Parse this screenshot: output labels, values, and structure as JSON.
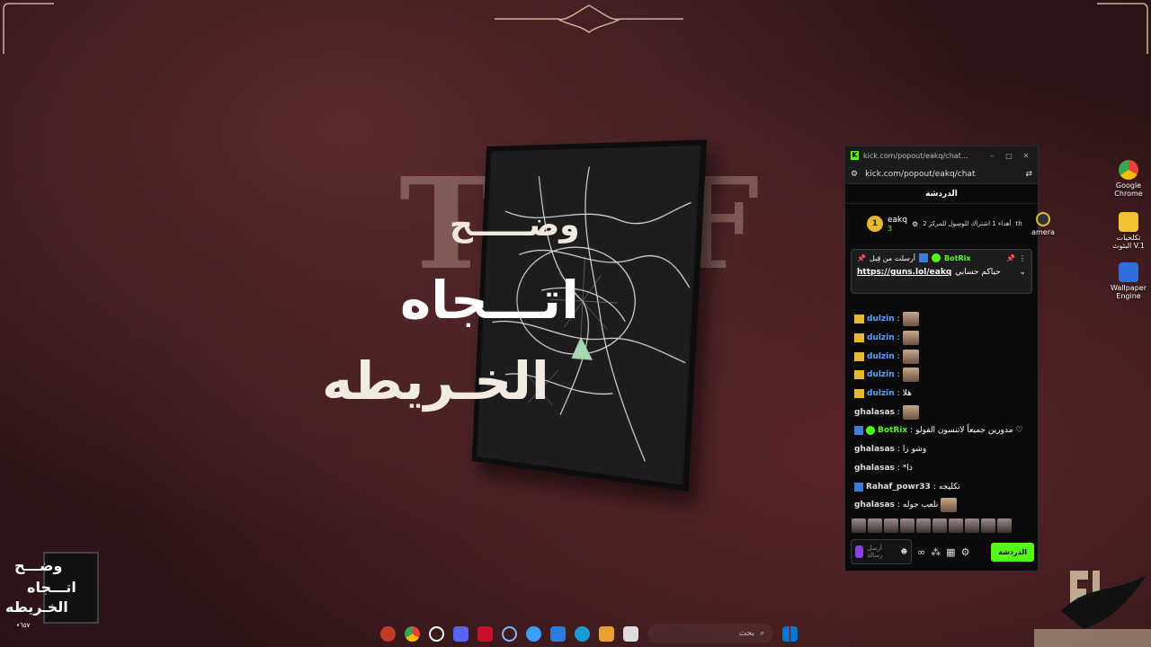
{
  "wallpaper": {
    "title_line1": "وضـــــح",
    "title_line2": "اتـــجاه",
    "title_line3": "الخـريطه",
    "bg_letters": [
      "T",
      "F"
    ]
  },
  "small_logo": {
    "line1": "وضـــح",
    "line2": "اتـــجاه",
    "line3": "الخـريطه",
    "version": "•٦٥٧"
  },
  "chat_window": {
    "tab_title": "kick.com/popout/eakq/chat...",
    "url": "kick.com/popout/eakq/chat",
    "header": "الدردشة",
    "leaderboard": {
      "rank": "1",
      "username": "eakq",
      "count": "3",
      "gift_text": "أهداء 1 اشتراك للوصول للمركز 2",
      "suffix": "th"
    },
    "pinned": {
      "label": "أرسلت من قِبل",
      "bot": "BotRix",
      "link": "https://guns.lol/eakq",
      "caption": "حياكم حسابي"
    },
    "messages": [
      {
        "user": "dulzin",
        "text": "",
        "color": "blue",
        "crown": true,
        "emote": true
      },
      {
        "user": "dulzin",
        "text": "",
        "color": "blue",
        "crown": true,
        "emote": true
      },
      {
        "user": "dulzin",
        "text": "",
        "color": "blue",
        "crown": true,
        "emote": true
      },
      {
        "user": "dulzin",
        "text": "",
        "color": "blue",
        "crown": true,
        "emote": true
      },
      {
        "user": "dulzin",
        "text": "هلا",
        "color": "blue",
        "crown": true,
        "emote": false
      },
      {
        "user": "ghalasas",
        "text": "",
        "color": "white",
        "crown": false,
        "emote": true
      },
      {
        "user": "BotRix",
        "text": "مدورين جميعاً لاتنسون الفولو",
        "color": "green",
        "crown": false,
        "emote": false
      },
      {
        "user": "ghalasas",
        "text": "وشو را",
        "color": "white",
        "crown": false,
        "emote": false
      },
      {
        "user": "ghalasas",
        "text": "*ذا",
        "color": "white",
        "crown": false,
        "emote": false
      },
      {
        "user": "Rahaf_powr33",
        "text": "تكليجه",
        "color": "white",
        "crown": false,
        "emote": false
      },
      {
        "user": "ghalasas",
        "text": "نلعب جوله",
        "color": "white",
        "crown": false,
        "emote": true
      }
    ],
    "input_placeholder": "أرسل رسالة",
    "send_button": "الدردشة"
  },
  "desktop_icons": [
    {
      "label1": "Google",
      "label2": "Chrome",
      "color": "#e8e8e8"
    },
    {
      "label1": "تكلخيات",
      "label2": "البثوث V.1",
      "color": "#f2c230"
    },
    {
      "label1": "Wallpaper",
      "label2": "Engine",
      "color": "#2f6fdc"
    }
  ],
  "partial_icon_label": "amera",
  "taskbar": {
    "search_placeholder": "بحث"
  },
  "colors": {
    "accent": "#53fc18",
    "username_blue": "#5aa2ff",
    "gold": "#e8b92f"
  }
}
